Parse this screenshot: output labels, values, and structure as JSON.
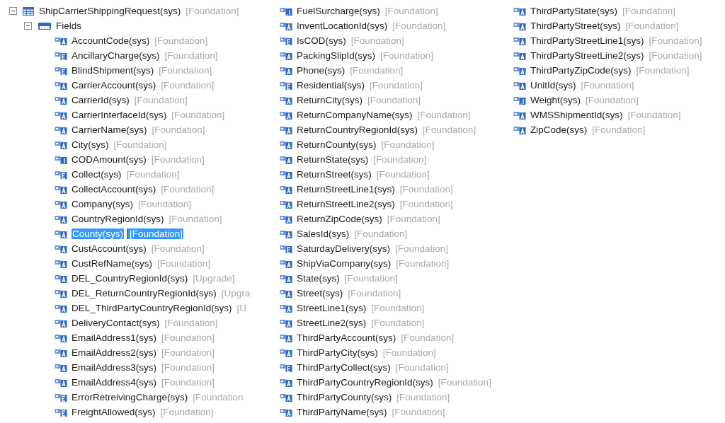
{
  "root": {
    "name": "ShipCarrierShippingRequest(sys)",
    "layer": "[Foundation]",
    "expanded": true
  },
  "group": {
    "label": "Fields",
    "expanded": true
  },
  "columns": [
    [
      {
        "name": "AccountCode(sys)",
        "layer": "[Foundation]",
        "kind": "string",
        "selected": false
      },
      {
        "name": "AncillaryCharge(sys)",
        "layer": "[Foundation]",
        "kind": "enum",
        "selected": false
      },
      {
        "name": "BlindShipment(sys)",
        "layer": "[Foundation]",
        "kind": "enum",
        "selected": false
      },
      {
        "name": "CarrierAccount(sys)",
        "layer": "[Foundation]",
        "kind": "string",
        "selected": false
      },
      {
        "name": "CarrierId(sys)",
        "layer": "[Foundation]",
        "kind": "string",
        "selected": false
      },
      {
        "name": "CarrierInterfaceId(sys)",
        "layer": "[Foundation]",
        "kind": "string",
        "selected": false
      },
      {
        "name": "CarrierName(sys)",
        "layer": "[Foundation]",
        "kind": "string",
        "selected": false
      },
      {
        "name": "City(sys)",
        "layer": "[Foundation]",
        "kind": "string",
        "selected": false
      },
      {
        "name": "CODAmount(sys)",
        "layer": "[Foundation]",
        "kind": "real",
        "selected": false
      },
      {
        "name": "Collect(sys)",
        "layer": "[Foundation]",
        "kind": "enum",
        "selected": false
      },
      {
        "name": "CollectAccount(sys)",
        "layer": "[Foundation]",
        "kind": "string",
        "selected": false
      },
      {
        "name": "Company(sys)",
        "layer": "[Foundation]",
        "kind": "string",
        "selected": false
      },
      {
        "name": "CountryRegionId(sys)",
        "layer": "[Foundation]",
        "kind": "string",
        "selected": false
      },
      {
        "name": "County(sys)",
        "layer": "[Foundation]",
        "kind": "string",
        "selected": true
      },
      {
        "name": "CustAccount(sys)",
        "layer": "[Foundation]",
        "kind": "string",
        "selected": false
      },
      {
        "name": "CustRefName(sys)",
        "layer": "[Foundation]",
        "kind": "string",
        "selected": false
      },
      {
        "name": "DEL_CountryRegionId(sys)",
        "layer": "[Upgrade]",
        "kind": "string",
        "selected": false
      },
      {
        "name": "DEL_ReturnCountryRegionId(sys)",
        "layer": "[Upgra",
        "kind": "string",
        "selected": false
      },
      {
        "name": "DEL_ThirdPartyCountryRegionId(sys)",
        "layer": "[U",
        "kind": "string",
        "selected": false
      },
      {
        "name": "DeliveryContact(sys)",
        "layer": "[Foundation]",
        "kind": "string",
        "selected": false
      },
      {
        "name": "EmailAddress1(sys)",
        "layer": "[Foundation]",
        "kind": "string",
        "selected": false
      },
      {
        "name": "EmailAddress2(sys)",
        "layer": "[Foundation]",
        "kind": "string",
        "selected": false
      },
      {
        "name": "EmailAddress3(sys)",
        "layer": "[Foundation]",
        "kind": "string",
        "selected": false
      },
      {
        "name": "EmailAddress4(sys)",
        "layer": "[Foundation]",
        "kind": "string",
        "selected": false
      },
      {
        "name": "ErrorRetreivingCharge(sys)",
        "layer": "[Foundation",
        "kind": "enum",
        "selected": false
      },
      {
        "name": "FreightAllowed(sys)",
        "layer": "[Foundation]",
        "kind": "enum",
        "selected": false
      }
    ],
    [
      {
        "name": "FuelSurcharge(sys)",
        "layer": "[Foundation]",
        "kind": "real",
        "selected": false
      },
      {
        "name": "InventLocationId(sys)",
        "layer": "[Foundation]",
        "kind": "string",
        "selected": false
      },
      {
        "name": "IsCOD(sys)",
        "layer": "[Foundation]",
        "kind": "enum",
        "selected": false
      },
      {
        "name": "PackingSlipId(sys)",
        "layer": "[Foundation]",
        "kind": "string",
        "selected": false
      },
      {
        "name": "Phone(sys)",
        "layer": "[Foundation]",
        "kind": "string",
        "selected": false
      },
      {
        "name": "Residential(sys)",
        "layer": "[Foundation]",
        "kind": "enum",
        "selected": false
      },
      {
        "name": "ReturnCity(sys)",
        "layer": "[Foundation]",
        "kind": "string",
        "selected": false
      },
      {
        "name": "ReturnCompanyName(sys)",
        "layer": "[Foundation]",
        "kind": "string",
        "selected": false
      },
      {
        "name": "ReturnCountryRegionId(sys)",
        "layer": "[Foundation]",
        "kind": "string",
        "selected": false
      },
      {
        "name": "ReturnCounty(sys)",
        "layer": "[Foundation]",
        "kind": "string",
        "selected": false
      },
      {
        "name": "ReturnState(sys)",
        "layer": "[Foundation]",
        "kind": "string",
        "selected": false
      },
      {
        "name": "ReturnStreet(sys)",
        "layer": "[Foundation]",
        "kind": "string",
        "selected": false
      },
      {
        "name": "ReturnStreetLine1(sys)",
        "layer": "[Foundation]",
        "kind": "string",
        "selected": false
      },
      {
        "name": "ReturnStreetLine2(sys)",
        "layer": "[Foundation]",
        "kind": "string",
        "selected": false
      },
      {
        "name": "ReturnZipCode(sys)",
        "layer": "[Foundation]",
        "kind": "string",
        "selected": false
      },
      {
        "name": "SalesId(sys)",
        "layer": "[Foundation]",
        "kind": "string",
        "selected": false
      },
      {
        "name": "SaturdayDelivery(sys)",
        "layer": "[Foundation]",
        "kind": "enum",
        "selected": false
      },
      {
        "name": "ShipViaCompany(sys)",
        "layer": "[Foundation]",
        "kind": "string",
        "selected": false
      },
      {
        "name": "State(sys)",
        "layer": "[Foundation]",
        "kind": "string",
        "selected": false
      },
      {
        "name": "Street(sys)",
        "layer": "[Foundation]",
        "kind": "string",
        "selected": false
      },
      {
        "name": "StreetLine1(sys)",
        "layer": "[Foundation]",
        "kind": "string",
        "selected": false
      },
      {
        "name": "StreetLine2(sys)",
        "layer": "[Foundation]",
        "kind": "string",
        "selected": false
      },
      {
        "name": "ThirdPartyAccount(sys)",
        "layer": "[Foundation]",
        "kind": "string",
        "selected": false
      },
      {
        "name": "ThirdPartyCity(sys)",
        "layer": "[Foundation]",
        "kind": "string",
        "selected": false
      },
      {
        "name": "ThirdPartyCollect(sys)",
        "layer": "[Foundation]",
        "kind": "enum",
        "selected": false
      },
      {
        "name": "ThirdPartyCountryRegionId(sys)",
        "layer": "[Foundation]",
        "kind": "string",
        "selected": false
      },
      {
        "name": "ThirdPartyCounty(sys)",
        "layer": "[Foundation]",
        "kind": "string",
        "selected": false
      },
      {
        "name": "ThirdPartyName(sys)",
        "layer": "[Foundation]",
        "kind": "string",
        "selected": false
      }
    ],
    [
      {
        "name": "ThirdPartyState(sys)",
        "layer": "[Foundation]",
        "kind": "string",
        "selected": false
      },
      {
        "name": "ThirdPartyStreet(sys)",
        "layer": "[Foundation]",
        "kind": "string",
        "selected": false
      },
      {
        "name": "ThirdPartyStreetLine1(sys)",
        "layer": "[Foundation]",
        "kind": "string",
        "selected": false
      },
      {
        "name": "ThirdPartyStreetLine2(sys)",
        "layer": "[Foundation]",
        "kind": "string",
        "selected": false
      },
      {
        "name": "ThirdPartyZipCode(sys)",
        "layer": "[Foundation]",
        "kind": "string",
        "selected": false
      },
      {
        "name": "UnitId(sys)",
        "layer": "[Foundation]",
        "kind": "string",
        "selected": false
      },
      {
        "name": "Weight(sys)",
        "layer": "[Foundation]",
        "kind": "real",
        "selected": false
      },
      {
        "name": "WMSShipmentId(sys)",
        "layer": "[Foundation]",
        "kind": "string",
        "selected": false
      },
      {
        "name": "ZipCode(sys)",
        "layer": "[Foundation]",
        "kind": "string",
        "selected": false
      }
    ]
  ]
}
